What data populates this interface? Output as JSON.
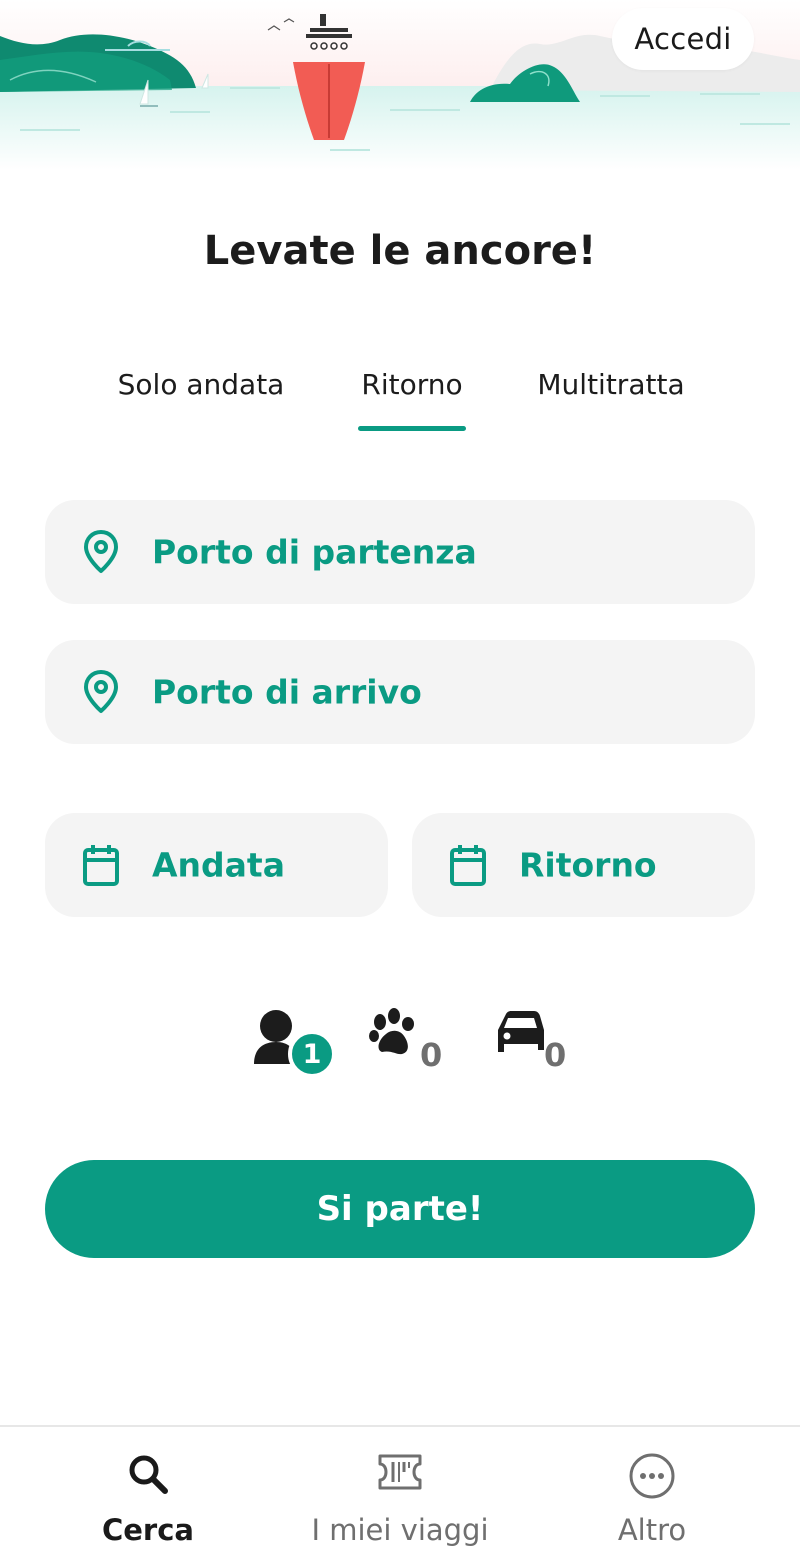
{
  "header": {
    "login_label": "Accedi"
  },
  "page": {
    "title": "Levate le ancore!"
  },
  "tabs": [
    {
      "label": "Solo andata",
      "selected": false
    },
    {
      "label": "Ritorno",
      "selected": true
    },
    {
      "label": "Multitratta",
      "selected": false
    }
  ],
  "form": {
    "departure_port": {
      "placeholder": "Porto di partenza",
      "icon": "location-pin-icon"
    },
    "arrival_port": {
      "placeholder": "Porto di arrivo",
      "icon": "location-pin-icon"
    },
    "outbound_date": {
      "placeholder": "Andata",
      "icon": "calendar-icon"
    },
    "return_date": {
      "placeholder": "Ritorno",
      "icon": "calendar-icon"
    }
  },
  "counters": {
    "passengers": {
      "icon": "person-icon",
      "value": "1"
    },
    "pets": {
      "icon": "paw-icon",
      "value": "0"
    },
    "vehicles": {
      "icon": "car-icon",
      "value": "0"
    }
  },
  "actions": {
    "search_label": "Si parte!"
  },
  "bottom_nav": [
    {
      "label": "Cerca",
      "icon": "search-icon",
      "active": true
    },
    {
      "label": "I miei viaggi",
      "icon": "ticket-icon",
      "active": false
    },
    {
      "label": "Altro",
      "icon": "more-icon",
      "active": false
    }
  ],
  "colors": {
    "accent": "#0a9b83",
    "ship": "#f25c54",
    "field_bg": "#f4f4f4",
    "text": "#1c1c1c",
    "muted": "#6f6f6f"
  }
}
